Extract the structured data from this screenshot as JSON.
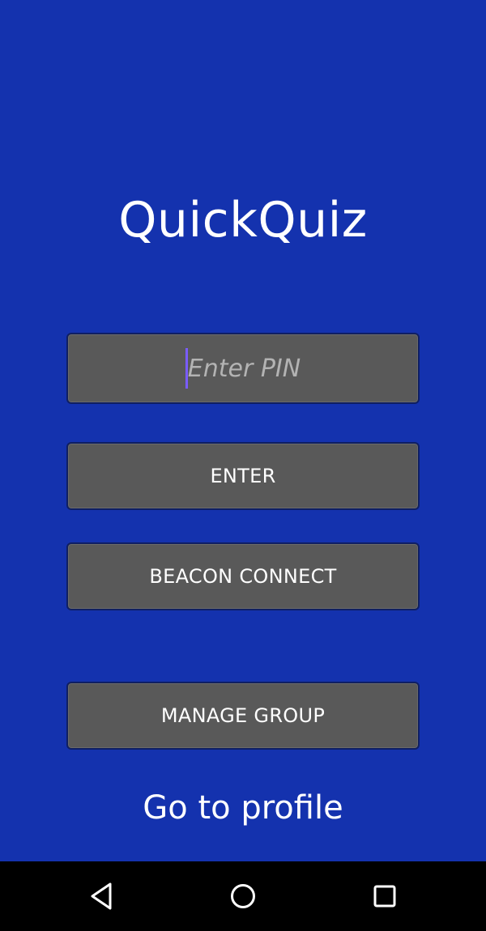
{
  "app": {
    "title": "QuickQuiz"
  },
  "pin": {
    "placeholder": "Enter PIN",
    "value": ""
  },
  "buttons": {
    "enter": "ENTER",
    "beacon": "BEACON CONNECT",
    "manage": "MANAGE GROUP"
  },
  "links": {
    "profile": "Go to profile"
  },
  "navbar": {
    "back_icon": "back-triangle-icon",
    "home_icon": "home-circle-icon",
    "recents_icon": "recents-square-icon"
  },
  "colors": {
    "background": "#1432ae",
    "button": "#595959",
    "button_border": "#0f1f63",
    "text": "#ffffff",
    "placeholder": "#b3b3b3",
    "caret": "#7a5cff",
    "navbar": "#000000"
  }
}
